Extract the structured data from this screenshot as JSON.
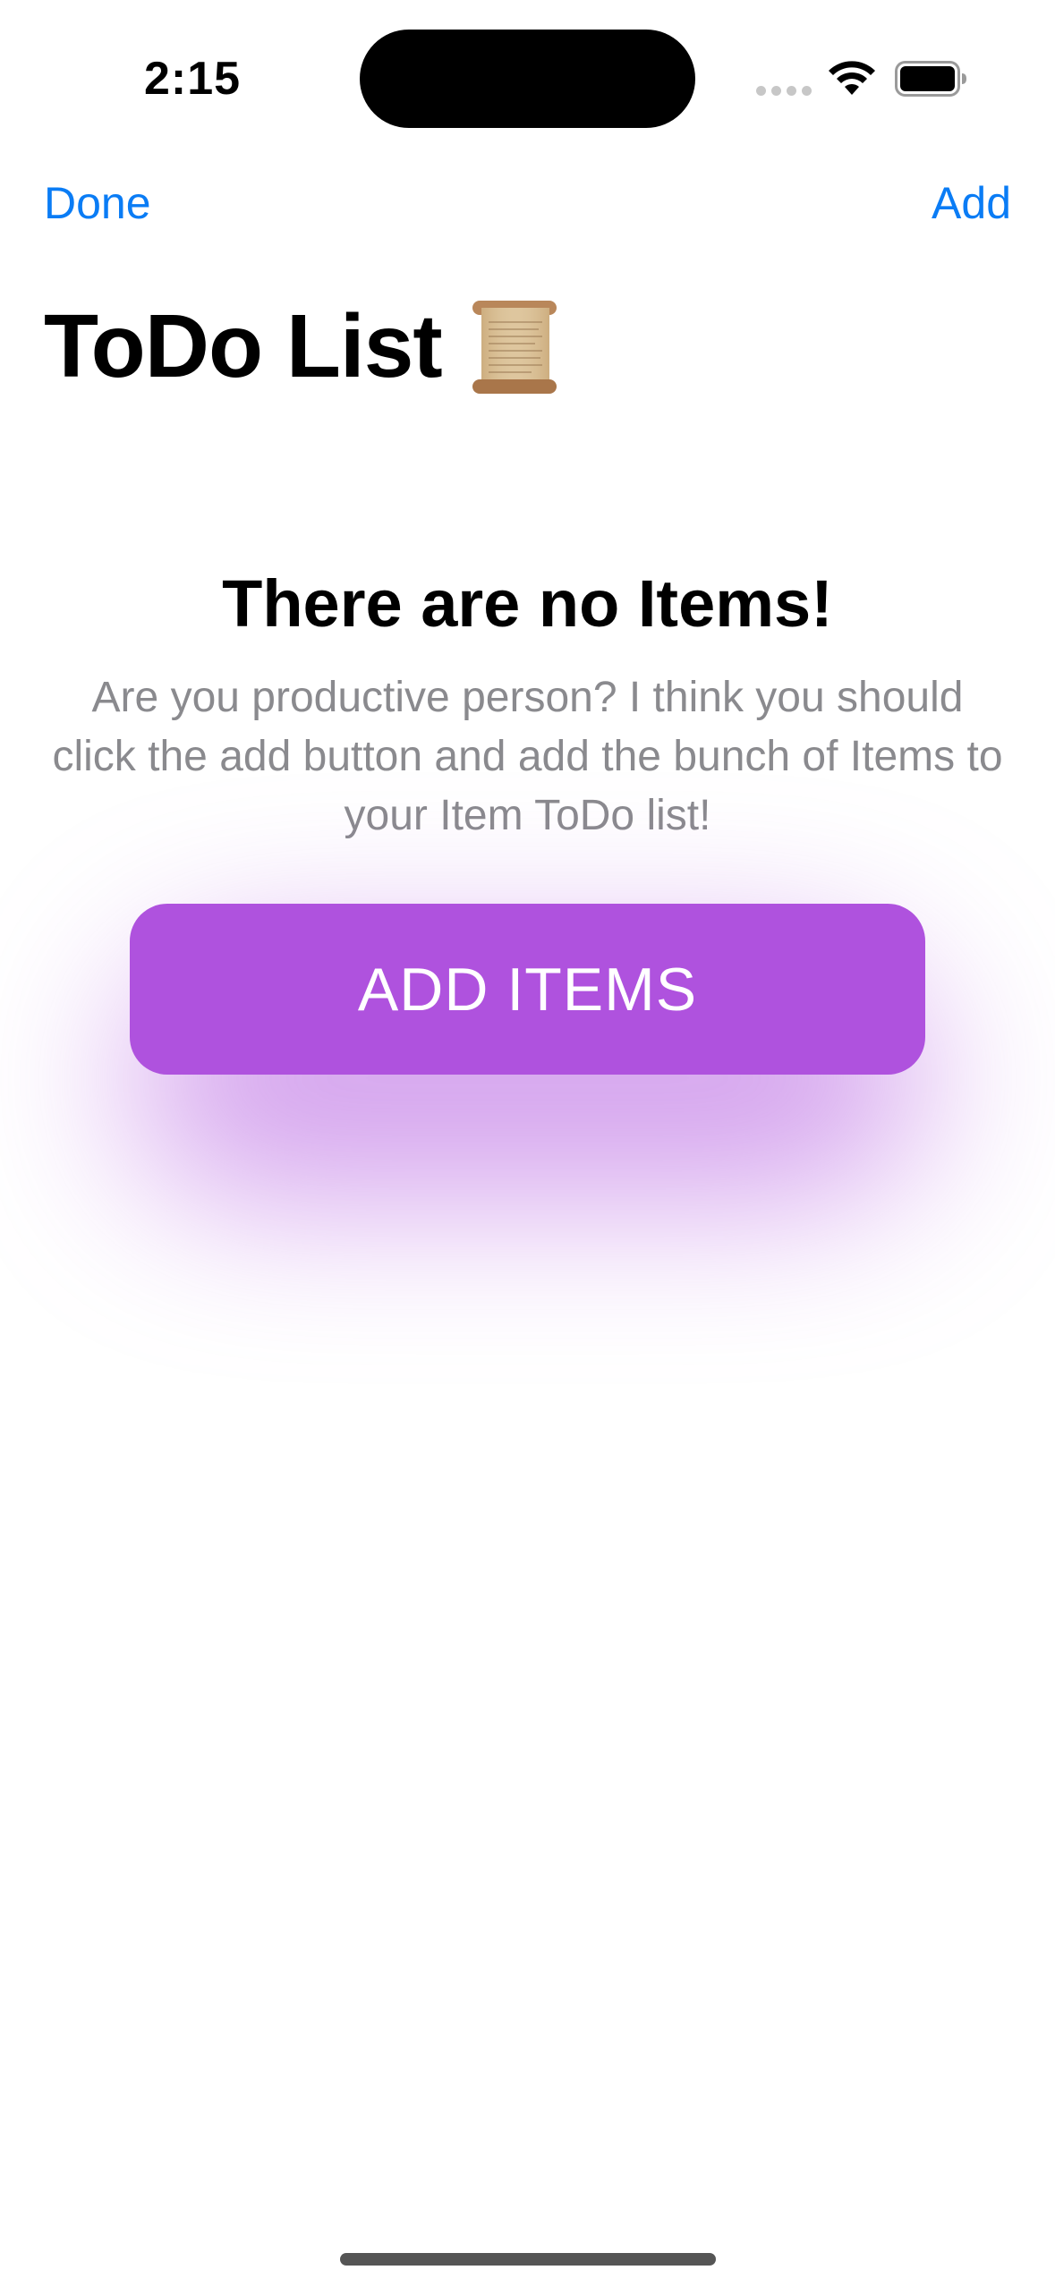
{
  "status_bar": {
    "time": "2:15"
  },
  "nav": {
    "done_label": "Done",
    "add_label": "Add"
  },
  "page": {
    "title": "ToDo List"
  },
  "empty_state": {
    "title": "There are no Items!",
    "message": "Are you productive person? I think you should click the add button and add the bunch of Items to your Item ToDo list!",
    "button_label": "ADD ITEMS"
  },
  "colors": {
    "accent_blue": "#0a7cf5",
    "button_purple": "#af52de",
    "secondary_text": "#8a8a8e"
  },
  "icons": {
    "title_emoji": "scroll-icon",
    "wifi": "wifi-icon",
    "battery": "battery-icon"
  }
}
